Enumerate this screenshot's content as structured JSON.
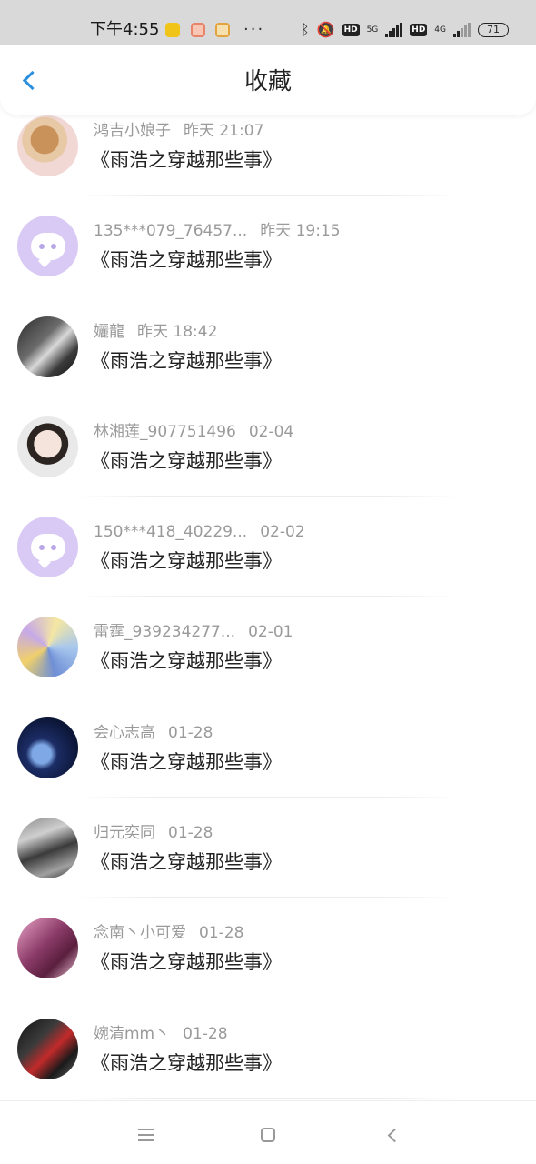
{
  "status_bar": {
    "time": "下午4:55",
    "dots": "···",
    "hd_label": "HD",
    "net_5g": "5G",
    "net_4g": "4G",
    "battery": "71"
  },
  "header": {
    "title": "收藏",
    "accent_color": "#2b8fe0"
  },
  "favorites": [
    {
      "user": "鸿吉小娘子",
      "time": "昨天 21:07",
      "title": "《雨浩之穿越那些事》",
      "avatar": "photo"
    },
    {
      "user": "135***079_76457...",
      "time": "昨天 19:15",
      "title": "《雨浩之穿越那些事》",
      "avatar": "default"
    },
    {
      "user": "孋龍",
      "time": "昨天 18:42",
      "title": "《雨浩之穿越那些事》",
      "avatar": "photo"
    },
    {
      "user": "林湘莲_907751496",
      "time": "02-04",
      "title": "《雨浩之穿越那些事》",
      "avatar": "photo"
    },
    {
      "user": "150***418_40229...",
      "time": "02-02",
      "title": "《雨浩之穿越那些事》",
      "avatar": "default"
    },
    {
      "user": "雷霆_939234277...",
      "time": "02-01",
      "title": "《雨浩之穿越那些事》",
      "avatar": "photo"
    },
    {
      "user": "会心志高",
      "time": "01-28",
      "title": "《雨浩之穿越那些事》",
      "avatar": "photo"
    },
    {
      "user": "归元奕同",
      "time": "01-28",
      "title": "《雨浩之穿越那些事》",
      "avatar": "photo"
    },
    {
      "user": "念南丶小可爱",
      "time": "01-28",
      "title": "《雨浩之穿越那些事》",
      "avatar": "photo"
    },
    {
      "user": "婉清mm丶",
      "time": "01-28",
      "title": "《雨浩之穿越那些事》",
      "avatar": "photo"
    }
  ],
  "icons": {
    "back": "chevron-left-icon",
    "default_avatar": "chat-bubble-icon",
    "nav_menu": "menu-icon",
    "nav_home": "home-square-icon",
    "nav_back": "back-chevron-icon"
  }
}
